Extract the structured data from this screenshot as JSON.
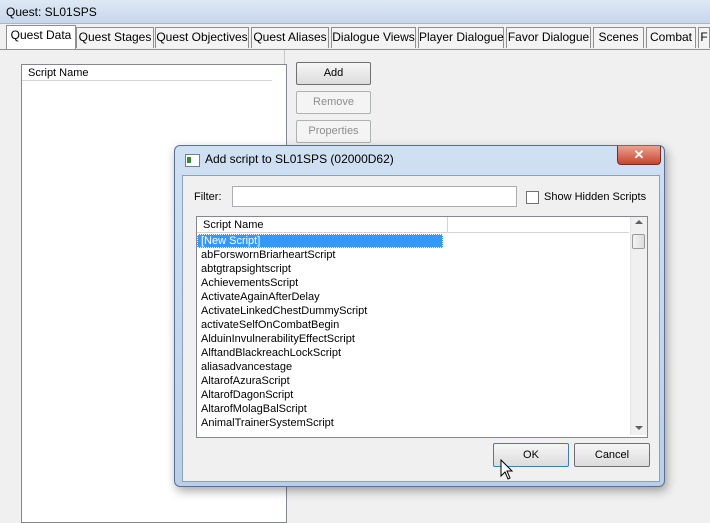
{
  "window": {
    "title": "Quest: SL01SPS"
  },
  "tabs": [
    {
      "label": "Quest Data"
    },
    {
      "label": "Quest Stages"
    },
    {
      "label": "Quest Objectives"
    },
    {
      "label": "Quest Aliases"
    },
    {
      "label": "Dialogue Views"
    },
    {
      "label": "Player Dialogue"
    },
    {
      "label": "Favor Dialogue"
    },
    {
      "label": "Scenes"
    },
    {
      "label": "Combat"
    },
    {
      "label": "F"
    }
  ],
  "scripts_panel": {
    "column_header": "Script Name",
    "buttons": {
      "add": "Add",
      "remove": "Remove",
      "properties": "Properties"
    }
  },
  "dialog": {
    "title": "Add script to SL01SPS (02000D62)",
    "close_glyph": "✕",
    "filter_label": "Filter:",
    "filter_value": "",
    "show_hidden_label": "Show Hidden Scripts",
    "show_hidden_checked": false,
    "list_header": "Script Name",
    "rows": [
      "[New Script]",
      "abForswornBriarheartScript",
      "abtgtrapsightscript",
      "AchievementsScript",
      "ActivateAgainAfterDelay",
      "ActivateLinkedChestDummyScript",
      "activateSelfOnCombatBegin",
      "AlduinInvulnerabilityEffectScript",
      "AlftandBlackreachLockScript",
      "aliasadvancestage",
      "AltarofAzuraScript",
      "AltarofDagonScript",
      "AltarofMolagBalScript",
      "AnimalTrainerSystemScript"
    ],
    "selected_index": 0,
    "ok_label": "OK",
    "cancel_label": "Cancel"
  }
}
